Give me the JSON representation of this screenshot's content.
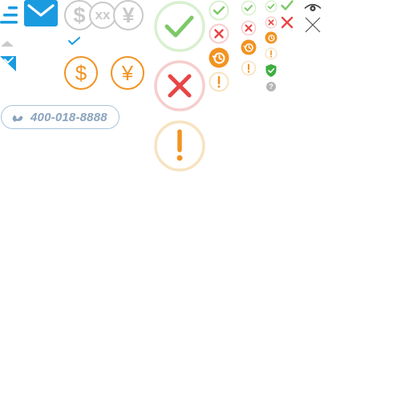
{
  "colors": {
    "blue": "#1a9be0",
    "grey": "#c9c9c9",
    "orange": "#f29322",
    "green": "#7cc868",
    "red": "#e84545",
    "pale_green": "#d8f0cf",
    "pale_red": "#f7cdcd",
    "pale_orange": "#f7e3c0",
    "phone_text": "#8aa3bd",
    "phone_border": "#a9c3dc"
  },
  "icons": {
    "menu": "menu-lines-icon",
    "mail": "mail-icon",
    "dollar": "dollar-icon",
    "yuan": "yuan-icon",
    "check": "check-icon",
    "close": "close-icon",
    "clock": "clock-icon",
    "exclamation": "exclamation-icon",
    "shield": "shield-check-icon",
    "question": "question-icon",
    "eye": "eye-icon"
  },
  "sprite": {
    "dollar_symbol": "$",
    "yuan_symbol": "¥",
    "xx_label": "xx",
    "exclamation_symbol": "!",
    "question_symbol": "?"
  },
  "contact": {
    "phone_number": "400-018-8888"
  }
}
